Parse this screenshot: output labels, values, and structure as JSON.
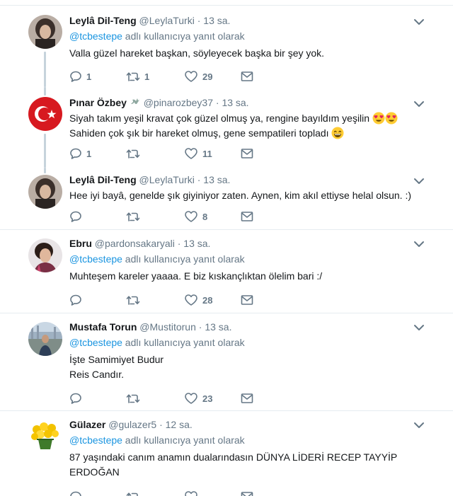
{
  "tweets": [
    {
      "name": "Leylâ Dil-Teng",
      "handle": "@LeylaTurki",
      "dot": "·",
      "time": "13 sa.",
      "reply_mention": "@tcbestepe",
      "reply_suffix": " adlı kullanıcıya yanıt olarak",
      "lines": [
        "Valla güzel hareket başkan, söyleyecek başka bir şey yok."
      ],
      "reply_count": "1",
      "retweet_count": "1",
      "like_count": "29",
      "avatar": "woman-dark-hair-avatar"
    },
    {
      "name": "Pınar Özbey",
      "handle": "@pinarozbey37",
      "dot": "·",
      "time": "13 sa.",
      "lines": [
        "Siyah takım yeşil kravat çok güzel olmuş ya, rengine bayıldım yeşilin",
        "Sahiden çok şık bir hareket olmuş, gene sempatileri topladı"
      ],
      "reply_count": "1",
      "retweet_count": "",
      "like_count": "11",
      "avatar": "turkish-flag-avatar"
    },
    {
      "name": "Leylâ Dil-Teng",
      "handle": "@LeylaTurki",
      "dot": "·",
      "time": "13 sa.",
      "lines": [
        "Hee iyi bayâ, genelde şık giyiniyor zaten. Aynen, kim akıl ettiyse helal olsun. :)"
      ],
      "reply_count": "",
      "retweet_count": "",
      "like_count": "8",
      "avatar": "woman-dark-hair-avatar"
    },
    {
      "name": "Ebru",
      "handle": "@pardonsakaryali",
      "dot": "·",
      "time": "13 sa.",
      "reply_mention": "@tcbestepe",
      "reply_suffix": " adlı kullanıcıya yanıt olarak",
      "lines": [
        "Muhteşem kareler yaaaa. E biz kıskançlıktan ölelim bari :/"
      ],
      "reply_count": "",
      "retweet_count": "",
      "like_count": "28",
      "avatar": "woman-photo-avatar"
    },
    {
      "name": "Mustafa Torun",
      "handle": "@Mustitorun",
      "dot": "·",
      "time": "13 sa.",
      "reply_mention": "@tcbestepe",
      "reply_suffix": " adlı kullanıcıya yanıt olarak",
      "lines": [
        "İşte Samimiyet Budur",
        "Reis Candır."
      ],
      "reply_count": "",
      "retweet_count": "",
      "like_count": "23",
      "avatar": "city-photo-avatar"
    },
    {
      "name": "Gülazer",
      "handle": "@gulazer5",
      "dot": "·",
      "time": "12 sa.",
      "reply_mention": "@tcbestepe",
      "reply_suffix": " adlı kullanıcıya yanıt olarak",
      "lines": [
        "87 yaşındaki canım anamın dualarındasın DÜNYA LİDERİ RECEP TAYYİP",
        "ERDOĞAN"
      ],
      "reply_count": "",
      "retweet_count": "",
      "like_count": "",
      "avatar": "yellow-flowers-avatar"
    }
  ],
  "colors": {
    "accent": "#1b95e0",
    "secondary_text": "#657786",
    "thread_line": "#c6d3dc",
    "border": "#e6ecf0"
  }
}
